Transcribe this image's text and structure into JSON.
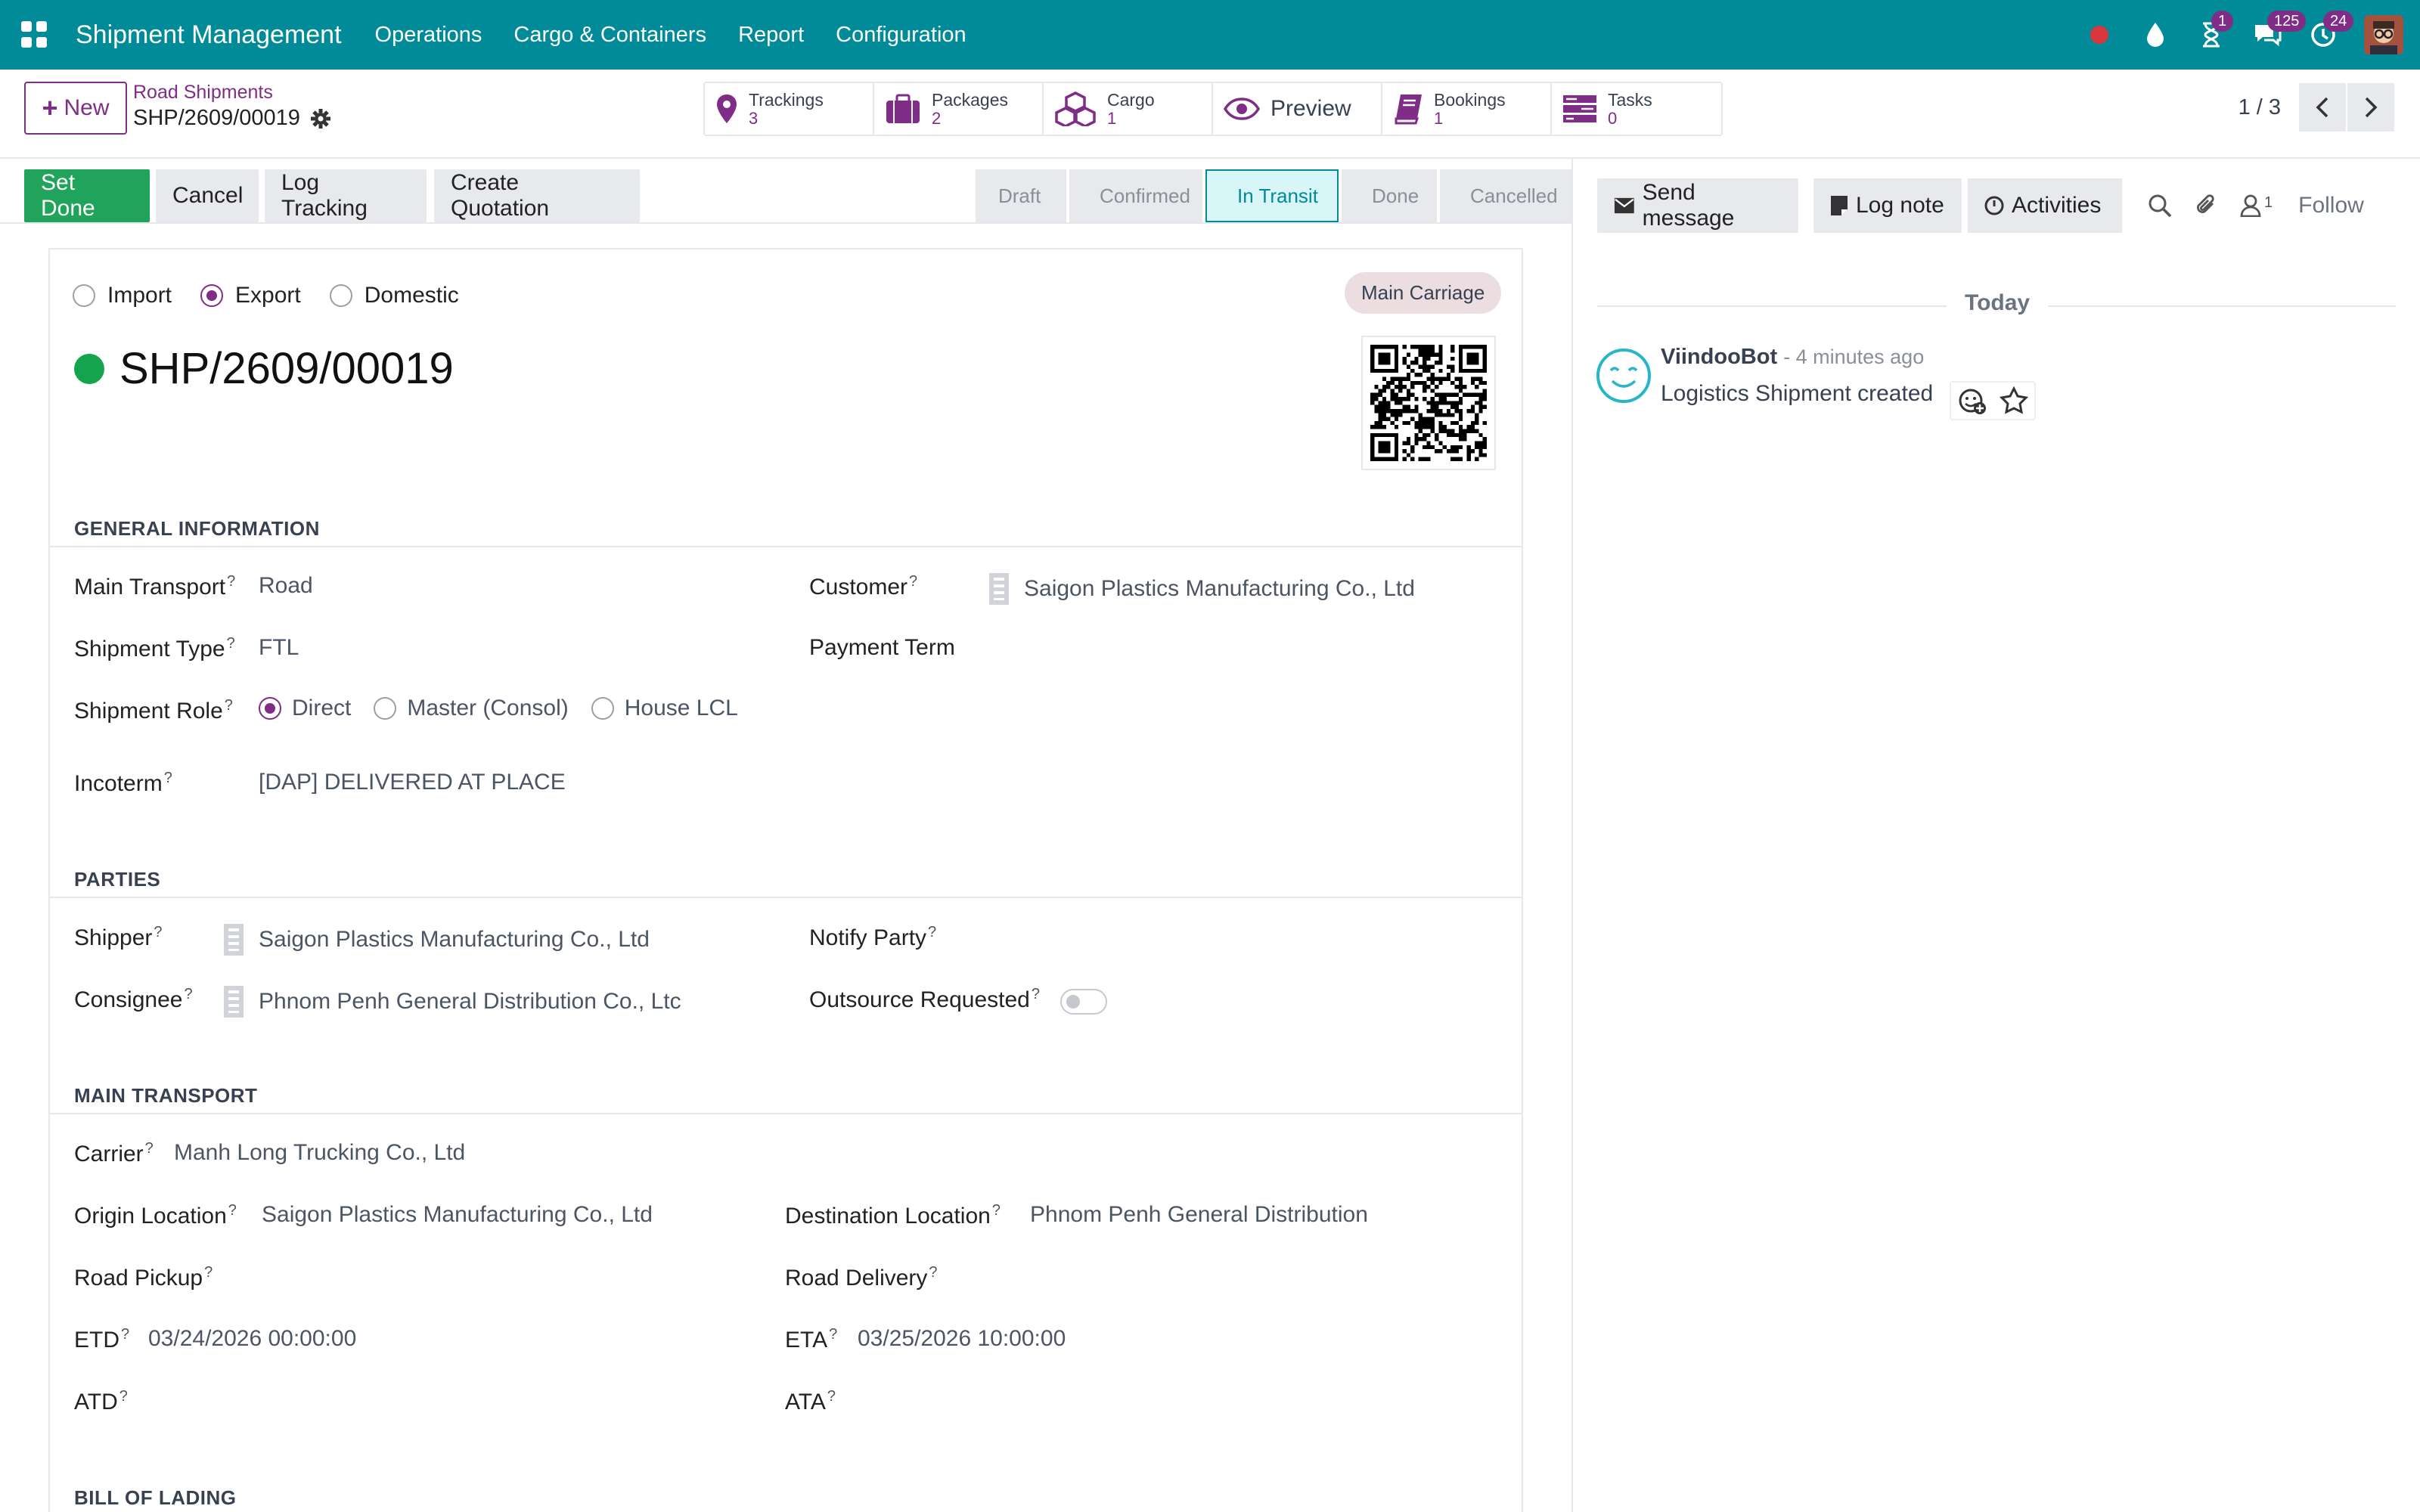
{
  "app": {
    "title": "Shipment Management",
    "menu": [
      "Operations",
      "Cargo & Containers",
      "Report",
      "Configuration"
    ],
    "badges": {
      "activities": "1",
      "messages": "125",
      "updates": "24"
    }
  },
  "control": {
    "new_label": "New",
    "breadcrumb_parent": "Road Shipments",
    "breadcrumb_current": "SHP/2609/00019",
    "smart_buttons": [
      {
        "label": "Trackings",
        "count": "3"
      },
      {
        "label": "Packages",
        "count": "2"
      },
      {
        "label": "Cargo",
        "count": "1"
      },
      {
        "label": "Preview"
      },
      {
        "label": "Bookings",
        "count": "1"
      },
      {
        "label": "Tasks",
        "count": "0"
      }
    ],
    "pager": "1 / 3"
  },
  "statusbar": {
    "actions": [
      "Set Done",
      "Cancel",
      "Log Tracking",
      "Create Quotation"
    ],
    "stages": [
      "Draft",
      "Confirmed",
      "In Transit",
      "Done",
      "Cancelled"
    ],
    "active_stage": "In Transit"
  },
  "form": {
    "direction_options": [
      "Import",
      "Export",
      "Domestic"
    ],
    "direction_selected": "Export",
    "stage_tag": "Main Carriage",
    "name": "SHP/2609/00019",
    "sections": {
      "general": "GENERAL INFORMATION",
      "parties": "PARTIES",
      "main_transport": "MAIN TRANSPORT",
      "bol": "BILL OF LADING"
    },
    "general": {
      "main_transport_label": "Main Transport",
      "main_transport": "Road",
      "shipment_type_label": "Shipment Type",
      "shipment_type": "FTL",
      "shipment_role_label": "Shipment Role",
      "role_options": [
        "Direct",
        "Master (Consol)",
        "House LCL"
      ],
      "role_selected": "Direct",
      "incoterm_label": "Incoterm",
      "incoterm": "[DAP] DELIVERED AT PLACE",
      "customer_label": "Customer",
      "customer": "Saigon Plastics Manufacturing Co., Ltd",
      "payment_term_label": "Payment Term"
    },
    "parties": {
      "shipper_label": "Shipper",
      "shipper": "Saigon Plastics Manufacturing Co., Ltd",
      "consignee_label": "Consignee",
      "consignee": "Phnom Penh General Distribution Co., Ltc",
      "notify_label": "Notify Party",
      "outsource_label": "Outsource Requested",
      "outsource": false
    },
    "transport": {
      "carrier_label": "Carrier",
      "carrier": "Manh Long Trucking Co., Ltd",
      "origin_label": "Origin Location",
      "origin": "Saigon Plastics Manufacturing Co., Ltd",
      "destination_label": "Destination Location",
      "destination": "Phnom Penh General Distribution",
      "road_pickup_label": "Road Pickup",
      "road_delivery_label": "Road Delivery",
      "etd_label": "ETD",
      "etd": "03/24/2026 00:00:00",
      "eta_label": "ETA",
      "eta": "03/25/2026 10:00:00",
      "atd_label": "ATD",
      "ata_label": "ATA"
    },
    "help_mark": "?"
  },
  "chatter": {
    "send_message": "Send message",
    "log_note": "Log note",
    "activities": "Activities",
    "followers_count": "1",
    "follow": "Follow",
    "day": "Today",
    "messages": [
      {
        "author": "ViindooBot",
        "time": "- 4 minutes ago",
        "body": "Logistics Shipment created"
      }
    ]
  },
  "colors": {
    "brand": "#018a97",
    "accent": "#7f2d86",
    "success": "#20a35b",
    "status_dot": "#14a44d"
  }
}
